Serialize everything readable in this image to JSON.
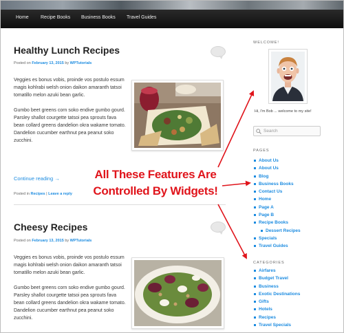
{
  "nav": {
    "items": [
      "Home",
      "Recipe Books",
      "Business Books",
      "Travel Guides"
    ]
  },
  "posts": [
    {
      "title": "Healthy Lunch Recipes",
      "meta_prefix": "Posted on",
      "date": "February 13, 2015",
      "by": "by",
      "author": "WPTutorials",
      "paragraph1": "Veggies es bonus vobis, proinde vos postulo essum magis kohlrabi welsh onion daikon amaranth tatsoi tomatillo melon azuki bean garlic.",
      "paragraph2": "Gumbo beet greens corn soko endive gumbo gourd. Parsley shallot courgette tatsoi pea sprouts fava bean collard greens dandelion okra wakame tomato. Dandelion cucumber earthnut pea peanut soko zucchini.",
      "continue": "Continue reading →",
      "posted_in": "Posted in",
      "category": "Recipes",
      "sep": "|",
      "reply": "Leave a reply"
    },
    {
      "title": "Cheesy Recipes",
      "meta_prefix": "Posted on",
      "date": "February 13, 2015",
      "by": "by",
      "author": "WPTutorials",
      "paragraph1": "Veggies es bonus vobis, proinde vos postulo essum magis kohlrabi welsh onion daikon amaranth tatsoi tomatillo melon azuki bean garlic.",
      "paragraph2": "Gumbo beet greens corn soko endive gumbo gourd. Parsley shallot courgette tatsoi pea sprouts fava bean collard greens dandelion okra wakame tomato. Dandelion cucumber earthnut pea peanut soko zucchini."
    }
  ],
  "sidebar": {
    "welcome_title": "WELCOME!",
    "welcome_text": "Hi, I'm Bob ... welcome to my site!",
    "search_placeholder": "Search",
    "pages_title": "PAGES",
    "pages": [
      "About Us",
      "About Us",
      "Blog",
      "Business Books",
      "Contact Us",
      "Home",
      "Page A",
      "Page B",
      "Recipe Books",
      "Dessert Recipes",
      "Specials",
      "Travel Guides"
    ],
    "categories_title": "CATEGORIES",
    "categories": [
      "Airfares",
      "Budget Travel",
      "Business",
      "Exotic Destinations",
      "Gifts",
      "Hotels",
      "Recipes",
      "Travel Specials"
    ]
  },
  "annotation": {
    "line1": "All These Features Are",
    "line2": "Controlled By Widgets!"
  },
  "colors": {
    "link": "#1b8be0",
    "annotation": "#e0141b",
    "nav_bg": "#1a1a1a"
  }
}
